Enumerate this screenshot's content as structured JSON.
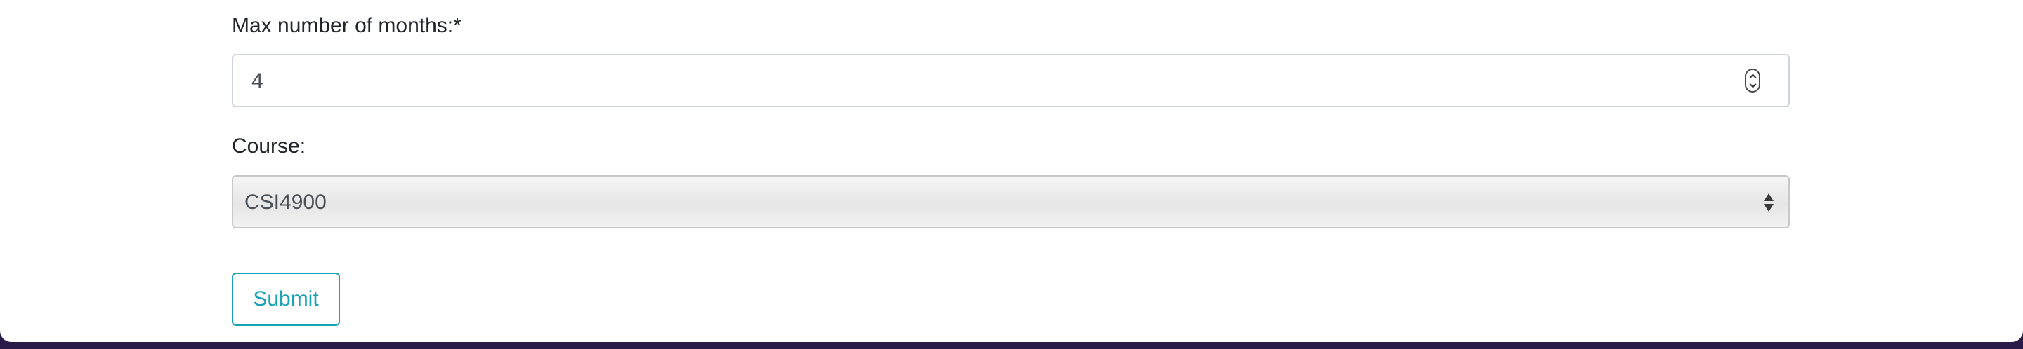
{
  "form": {
    "max_months": {
      "label": "Max number of months:*",
      "value": "4"
    },
    "course": {
      "label": "Course:",
      "selected": "CSI4900"
    },
    "submit_label": "Submit"
  },
  "colors": {
    "accent": "#17a2b8",
    "page_background": "#2a1a4a",
    "card_background": "#ffffff",
    "text": "#212529",
    "input_border": "#ced4da"
  },
  "icons": {
    "number_stepper": "stepper-icon",
    "select_arrows": "select-arrows-icon"
  }
}
